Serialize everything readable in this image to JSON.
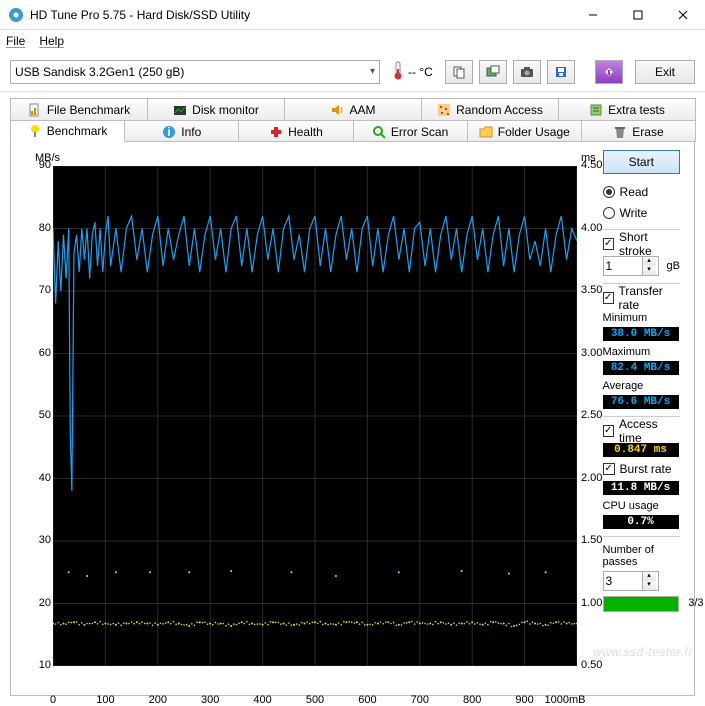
{
  "window": {
    "title": "HD Tune Pro 5.75 - Hard Disk/SSD Utility"
  },
  "menu": {
    "file": "File",
    "help": "Help"
  },
  "toolbar": {
    "drive": "USB Sandisk 3.2Gen1 (250 gB)",
    "temp": "-- °C",
    "exit": "Exit"
  },
  "tabs_top": [
    {
      "label": "File Benchmark"
    },
    {
      "label": "Disk monitor"
    },
    {
      "label": "AAM"
    },
    {
      "label": "Random Access"
    },
    {
      "label": "Extra tests"
    }
  ],
  "tabs_bottom": [
    {
      "label": "Benchmark"
    },
    {
      "label": "Info"
    },
    {
      "label": "Health"
    },
    {
      "label": "Error Scan"
    },
    {
      "label": "Folder Usage"
    },
    {
      "label": "Erase"
    }
  ],
  "side": {
    "start": "Start",
    "read": "Read",
    "write": "Write",
    "short_stroke": "Short stroke",
    "short_stroke_val": "1",
    "short_stroke_unit": "gB",
    "transfer_rate": "Transfer rate",
    "min_lbl": "Minimum",
    "min_val": "38.0 MB/s",
    "max_lbl": "Maximum",
    "max_val": "82.4 MB/s",
    "avg_lbl": "Average",
    "avg_val": "76.6 MB/s",
    "access_lbl": "Access time",
    "access_val": "0.847 ms",
    "burst_lbl": "Burst rate",
    "burst_val": "11.8 MB/s",
    "cpu_lbl": "CPU usage",
    "cpu_val": "0.7%",
    "passes_lbl": "Number of passes",
    "passes_val": "3",
    "progress_label": "3/3"
  },
  "chart_data": {
    "type": "line",
    "title": "",
    "y_left_label": "MB/s",
    "y_right_label": "ms",
    "x_unit": "mB",
    "xlim": [
      0,
      1000
    ],
    "y_left_lim": [
      10,
      90
    ],
    "y_right_lim": [
      0.5,
      4.5
    ],
    "y_left_ticks": [
      10,
      20,
      30,
      40,
      50,
      60,
      70,
      80,
      90
    ],
    "y_right_ticks": [
      0.5,
      1.0,
      1.5,
      2.0,
      2.5,
      3.0,
      3.5,
      4.0,
      4.5
    ],
    "x_ticks": [
      0,
      100,
      200,
      300,
      400,
      500,
      600,
      700,
      800,
      900,
      1000
    ],
    "series": [
      {
        "name": "transfer_rate",
        "axis": "left",
        "color": "#1ea0f0",
        "x": [
          0,
          5,
          10,
          15,
          20,
          25,
          30,
          33,
          36,
          40,
          45,
          50,
          55,
          60,
          65,
          70,
          75,
          80,
          85,
          90,
          95,
          100,
          105,
          110,
          120,
          130,
          140,
          150,
          160,
          170,
          180,
          190,
          200,
          210,
          220,
          230,
          240,
          250,
          260,
          270,
          280,
          290,
          300,
          310,
          320,
          330,
          340,
          350,
          360,
          370,
          380,
          390,
          400,
          410,
          420,
          430,
          440,
          450,
          460,
          470,
          480,
          490,
          500,
          510,
          520,
          530,
          540,
          550,
          560,
          570,
          580,
          590,
          600,
          610,
          620,
          630,
          640,
          650,
          660,
          670,
          680,
          690,
          700,
          710,
          720,
          730,
          740,
          750,
          760,
          770,
          780,
          790,
          800,
          810,
          820,
          830,
          840,
          850,
          860,
          870,
          880,
          890,
          900,
          910,
          920,
          930,
          940,
          950,
          960,
          970,
          980,
          990,
          1000
        ],
        "y": [
          80,
          68,
          78,
          70,
          79,
          72,
          80,
          47,
          38,
          76,
          79,
          73,
          80,
          75,
          80,
          72,
          79,
          81,
          74,
          80,
          73,
          79,
          82,
          74,
          80,
          73,
          80,
          82,
          75,
          80,
          73,
          79,
          82,
          74,
          80,
          75,
          79,
          82,
          74,
          80,
          73,
          79,
          82,
          75,
          80,
          73,
          80,
          82,
          74,
          80,
          73,
          79,
          82,
          75,
          80,
          73,
          80,
          82,
          75,
          79,
          73,
          80,
          82,
          74,
          80,
          73,
          79,
          82,
          75,
          80,
          73,
          80,
          82,
          74,
          80,
          73,
          79,
          82,
          75,
          80,
          73,
          80,
          81,
          74,
          80,
          73,
          79,
          82,
          75,
          80,
          73,
          79,
          82,
          75,
          80,
          73,
          79,
          82,
          74,
          80,
          73,
          79,
          82,
          75,
          78,
          74,
          80,
          73,
          79,
          82,
          75,
          80,
          78
        ]
      },
      {
        "name": "access_time",
        "axis": "right",
        "color": "#e8d838",
        "x": [
          0,
          20,
          40,
          60,
          80,
          100,
          120,
          140,
          160,
          180,
          200,
          220,
          240,
          260,
          280,
          300,
          320,
          340,
          360,
          380,
          400,
          420,
          440,
          460,
          480,
          500,
          520,
          540,
          560,
          580,
          600,
          620,
          640,
          660,
          680,
          700,
          720,
          740,
          760,
          780,
          800,
          820,
          840,
          860,
          880,
          900,
          920,
          940,
          960,
          980,
          1000
        ],
        "y": [
          0.84,
          0.84,
          0.85,
          0.83,
          0.85,
          0.84,
          0.83,
          0.84,
          0.85,
          0.84,
          0.83,
          0.85,
          0.84,
          0.82,
          0.85,
          0.84,
          0.84,
          0.82,
          0.85,
          0.84,
          0.83,
          0.85,
          0.84,
          0.83,
          0.84,
          0.85,
          0.84,
          0.83,
          0.85,
          0.85,
          0.83,
          0.84,
          0.85,
          0.83,
          0.85,
          0.84,
          0.84,
          0.85,
          0.83,
          0.84,
          0.85,
          0.83,
          0.85,
          0.84,
          0.82,
          0.85,
          0.84,
          0.83,
          0.85,
          0.84,
          0.84
        ]
      },
      {
        "name": "access_time_outliers",
        "axis": "right",
        "color": "#e8d838",
        "x": [
          30,
          65,
          120,
          185,
          260,
          340,
          455,
          540,
          660,
          780,
          870,
          940
        ],
        "y": [
          1.25,
          1.22,
          1.25,
          1.25,
          1.25,
          1.26,
          1.25,
          1.22,
          1.25,
          1.26,
          1.24,
          1.25
        ]
      }
    ]
  },
  "watermark": "www.ssd-tester.fr"
}
